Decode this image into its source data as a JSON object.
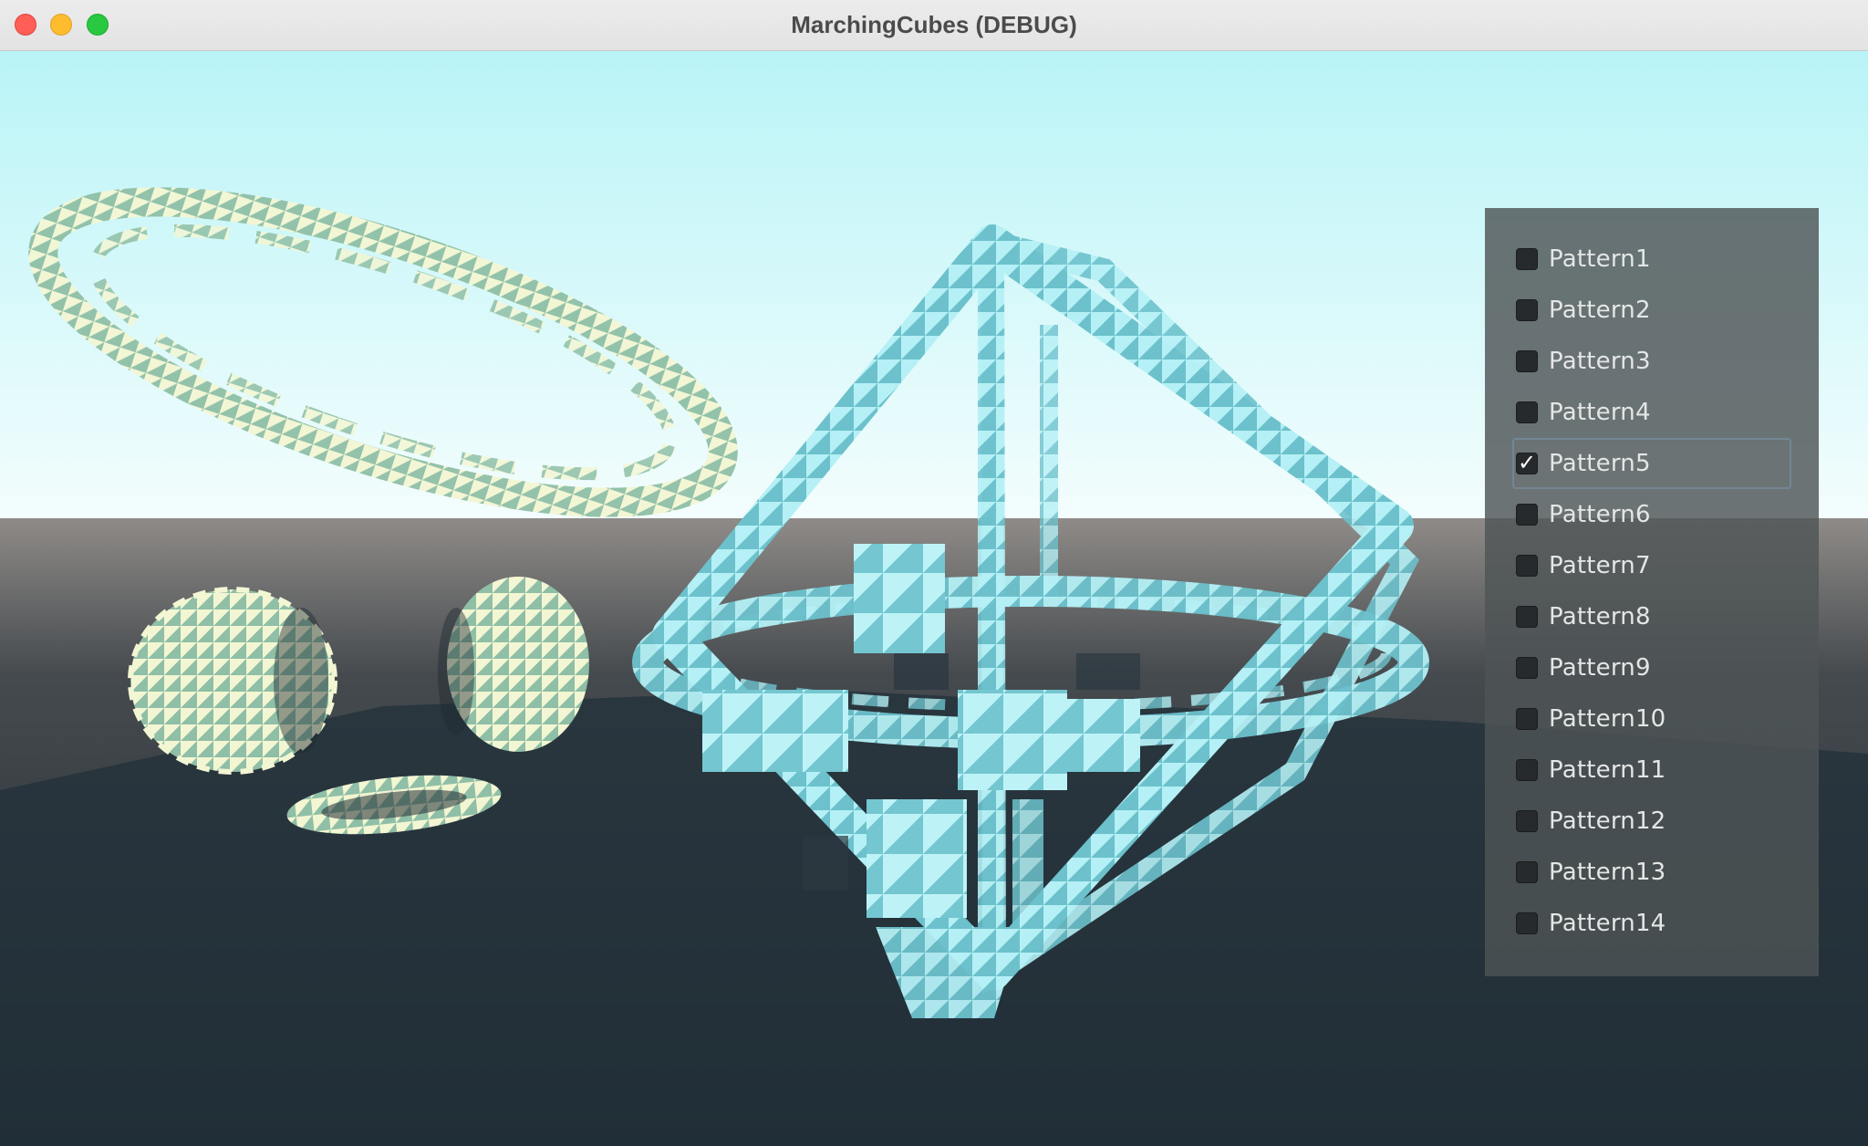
{
  "window": {
    "title": "MarchingCubes (DEBUG)"
  },
  "patterns": [
    {
      "label": "Pattern1",
      "checked": false
    },
    {
      "label": "Pattern2",
      "checked": false
    },
    {
      "label": "Pattern3",
      "checked": false
    },
    {
      "label": "Pattern4",
      "checked": false
    },
    {
      "label": "Pattern5",
      "checked": true
    },
    {
      "label": "Pattern6",
      "checked": false
    },
    {
      "label": "Pattern7",
      "checked": false
    },
    {
      "label": "Pattern8",
      "checked": false
    },
    {
      "label": "Pattern9",
      "checked": false
    },
    {
      "label": "Pattern10",
      "checked": false
    },
    {
      "label": "Pattern11",
      "checked": false
    },
    {
      "label": "Pattern12",
      "checked": false
    },
    {
      "label": "Pattern13",
      "checked": false
    },
    {
      "label": "Pattern14",
      "checked": false
    }
  ],
  "colors": {
    "sky_top": "#bff6f8",
    "sky_horizon": "#f2fdfd",
    "ground_far": "#8e8a87",
    "ground_near": "#1f2a31",
    "cream_mesh": "#f3f6d3",
    "cream_mesh_shade": "#8fbfa6",
    "cyan_mesh": "#a8ecf2",
    "cyan_mesh_shade": "#5fb8c4"
  },
  "icons": {
    "checkmark": "✓"
  }
}
